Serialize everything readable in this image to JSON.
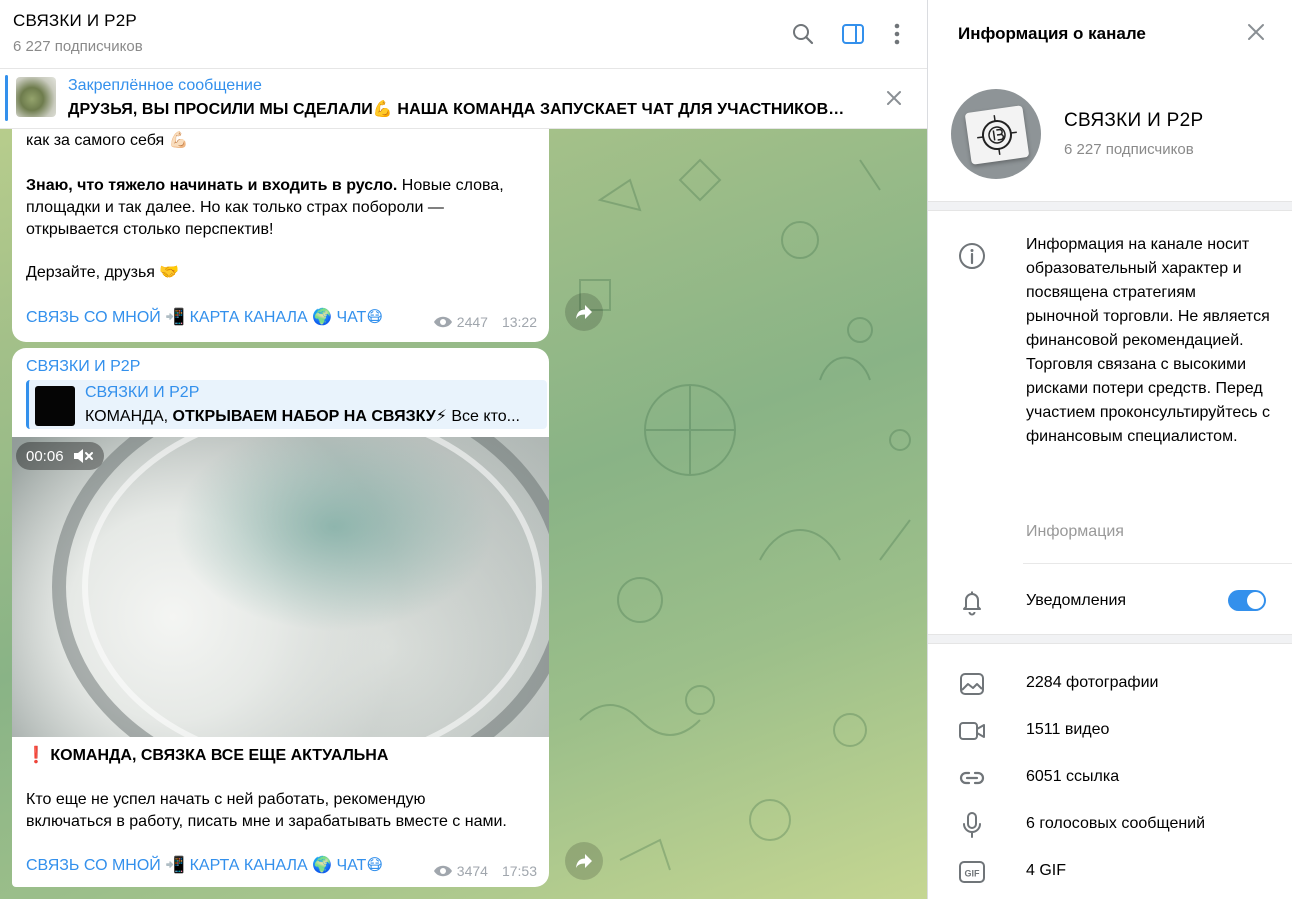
{
  "chat": {
    "title": "СВЯЗКИ И P2P",
    "subscribers": "6 227 подписчиков",
    "header_icons": [
      "search-icon",
      "sidebar-toggle-icon",
      "more-vertical-icon"
    ],
    "pinned": {
      "label": "Закреплённое сообщение",
      "text": "ДРУЗЬЯ, ВЫ ПРОСИЛИ МЫ СДЕЛАЛИ💪 НАША КОМАНДА ЗАПУСКАЕТ ЧАТ ДЛЯ УЧАСТНИКОВ К..."
    },
    "messages": [
      {
        "line1": "как за самого себя 💪🏻",
        "bold": "Знаю, что тяжело начинать и входить в русло.",
        "rest1": " Новые слова,",
        "line3": "площадки и так далее. Но как только страх побороли —",
        "line4": "открывается столько перспектив!",
        "line5": "Дерзайте, друзья 🤝",
        "links": "СВЯЗЬ СО МНОЙ 📲 КАРТА КАНАЛА 🌍 ЧАТ😷",
        "views": "2447",
        "time": "13:22"
      },
      {
        "sender": "СВЯЗКИ И P2P",
        "reply_title": "СВЯЗКИ И P2P",
        "reply_prefix": "КОМАНДА, ",
        "reply_bold": "ОТКРЫВАЕМ НАБОР НА СВЯЗКУ⚡",
        "reply_suffix": "  Все кто...",
        "video_time": "00:06",
        "video_progress": 0.19,
        "heading": "❗ КОМАНДА, СВЯЗКА ВСЕ ЕЩЕ АКТУАЛЬНА",
        "body1": "Кто еще не успел начать с ней работать, рекомендую",
        "body2": "включаться в работу, писать мне и зарабатывать вместе с нами.",
        "links": "СВЯЗЬ СО МНОЙ 📲 КАРТА КАНАЛА 🌍 ЧАТ😷",
        "views": "3474",
        "time": "17:53"
      }
    ]
  },
  "info": {
    "title": "Информация о канале",
    "name": "СВЯЗКИ И P2P",
    "subscribers": "6 227 подписчиков",
    "about": "Информация на канале носит образовательный характер и посвящена стратегиям рыночной торговли. Не является финансовой рекомендацией. Торговля связана с высокими рисками потери средств. Перед участием проконсультируйтесь с финансовым специалистом.",
    "about_label": "Информация",
    "notifications_label": "Уведомления",
    "notifications_on": true,
    "media": [
      {
        "icon": "photo-icon",
        "label": "2284 фотографии"
      },
      {
        "icon": "video-icon",
        "label": "1511 видео"
      },
      {
        "icon": "link-icon",
        "label": "6051 ссылка"
      },
      {
        "icon": "microphone-icon",
        "label": "6 голосовых сообщений"
      },
      {
        "icon": "gif-icon",
        "label": "4 GIF"
      }
    ]
  },
  "colors": {
    "accent": "#3390ec",
    "muted": "#8a8a8a"
  }
}
